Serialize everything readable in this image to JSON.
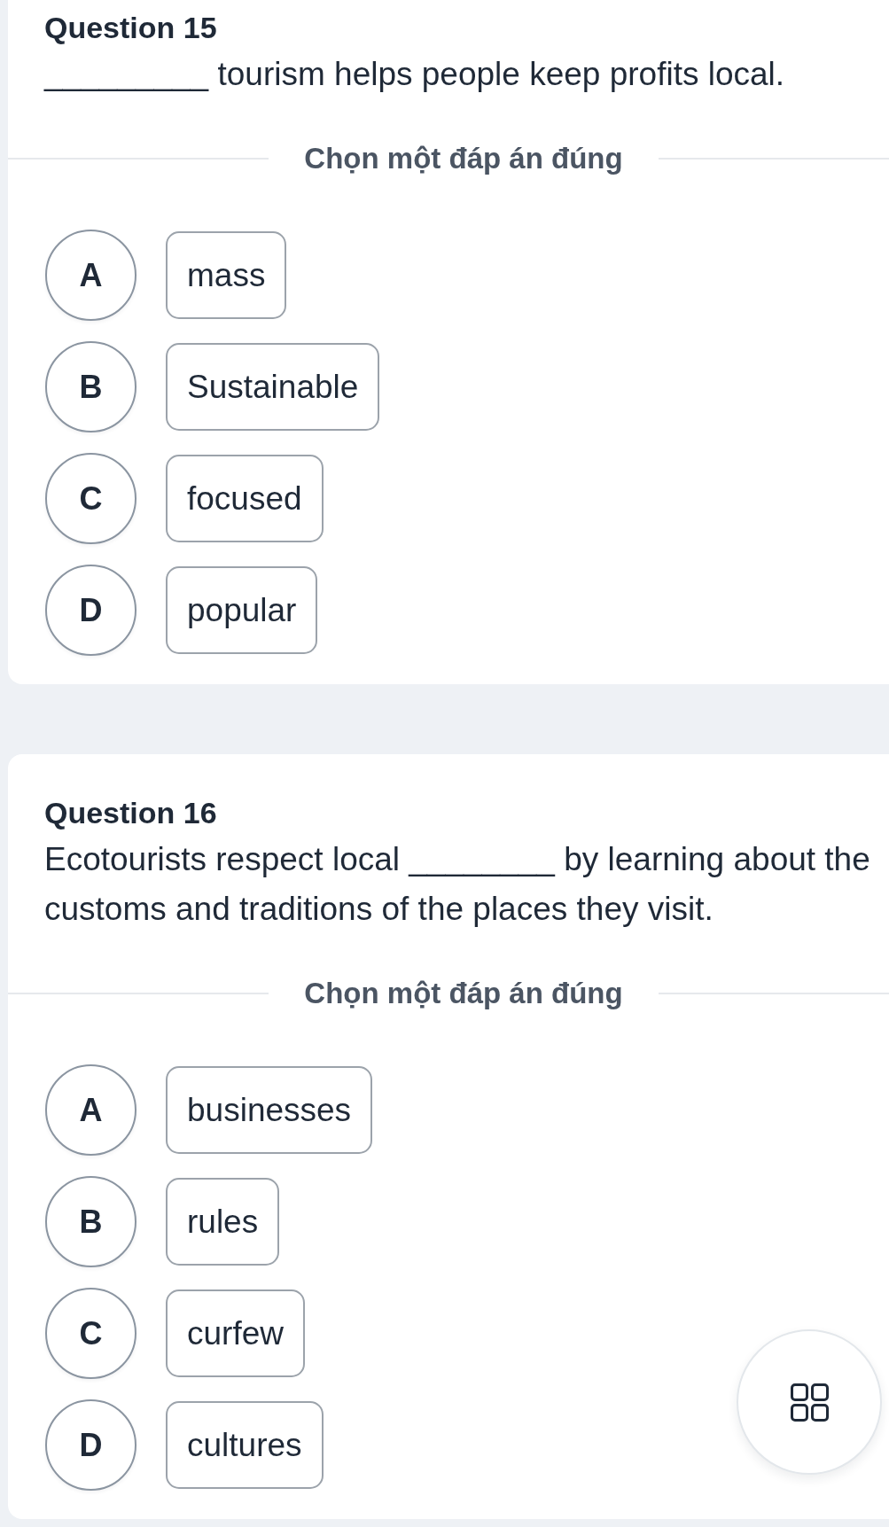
{
  "questions": [
    {
      "title": "Question 15",
      "prompt": "_________ tourism helps people keep profits local.",
      "instruction": "Chọn một đáp án đúng",
      "options": [
        {
          "letter": "A",
          "text": "mass",
          "selected": false
        },
        {
          "letter": "B",
          "text": "Sustainable",
          "selected": false
        },
        {
          "letter": "C",
          "text": "focused",
          "selected": false
        },
        {
          "letter": "D",
          "text": "popular",
          "selected": false
        }
      ]
    },
    {
      "title": "Question 16",
      "prompt": "Ecotourists respect local ________ by learning about the customs and traditions of the places they visit.",
      "instruction": "Chọn một đáp án đúng",
      "options": [
        {
          "letter": "A",
          "text": "businesses",
          "selected": false
        },
        {
          "letter": "B",
          "text": "rules",
          "selected": false
        },
        {
          "letter": "C",
          "text": "curfew",
          "selected": false
        },
        {
          "letter": "D",
          "text": "cultures",
          "selected": false
        }
      ]
    }
  ]
}
